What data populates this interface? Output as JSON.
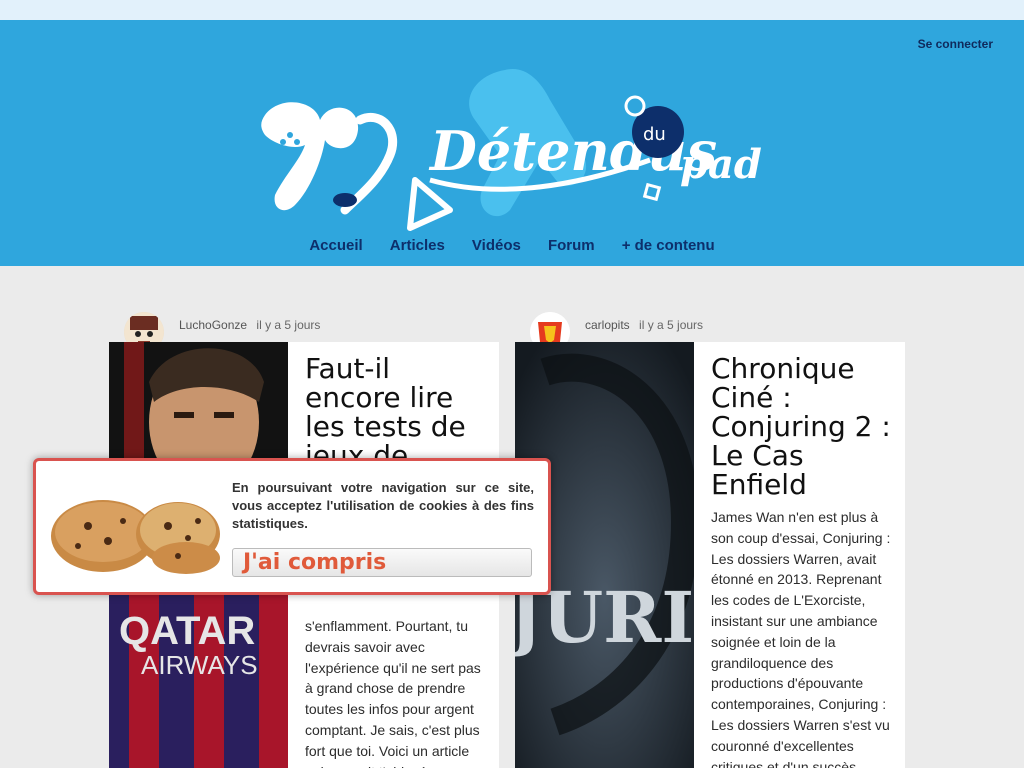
{
  "header": {
    "login_label": "Se connecter",
    "logo_text": "Détendus du pad",
    "nav": [
      {
        "label": "Accueil"
      },
      {
        "label": "Articles"
      },
      {
        "label": "Vidéos"
      },
      {
        "label": "Forum"
      },
      {
        "label": "+ de contenu"
      }
    ]
  },
  "posts": [
    {
      "author": "LuchoGonze",
      "time": "il y a 5 jours",
      "title": "Faut-il encore lire les tests de jeux de",
      "excerpt": "s'enflamment. Pourtant, tu devrais savoir avec l'expérience qu'il ne sert pas à grand chose de prendre toutes les infos pour argent comptant. Je sais, c'est plus fort que toi. Voici un article qui pourrait t'aider à relativiser tes",
      "image_text_1": "QATAR",
      "image_text_2": "AIRWAYS"
    },
    {
      "author": "carlopits",
      "time": "il y a 5 jours",
      "title": "Chronique Ciné : Conjuring 2 : Le Cas Enfield",
      "excerpt": "James Wan n'en est plus à son coup d'essai, Conjuring : Les dossiers Warren, avait étonné en 2013. Reprenant les codes de L'Exorciste, insistant sur une ambiance soignée et loin de la grandiloquence des productions d'épouvante contemporaines, Conjuring : Les dossiers Warren s'est vu couronné d'excellentes critiques et d'un succès",
      "image_text": "JURI"
    }
  ],
  "cookie_banner": {
    "message": "En poursuivant votre navigation sur ce site, vous acceptez l'utilisation de cookies à des fins statistiques.",
    "button_label": "J'ai compris"
  },
  "colors": {
    "header_bg": "#2fa6dd",
    "nav_text": "#0d2f6b",
    "cookie_border": "#d9534f",
    "cookie_button_text": "#e05a3a"
  }
}
